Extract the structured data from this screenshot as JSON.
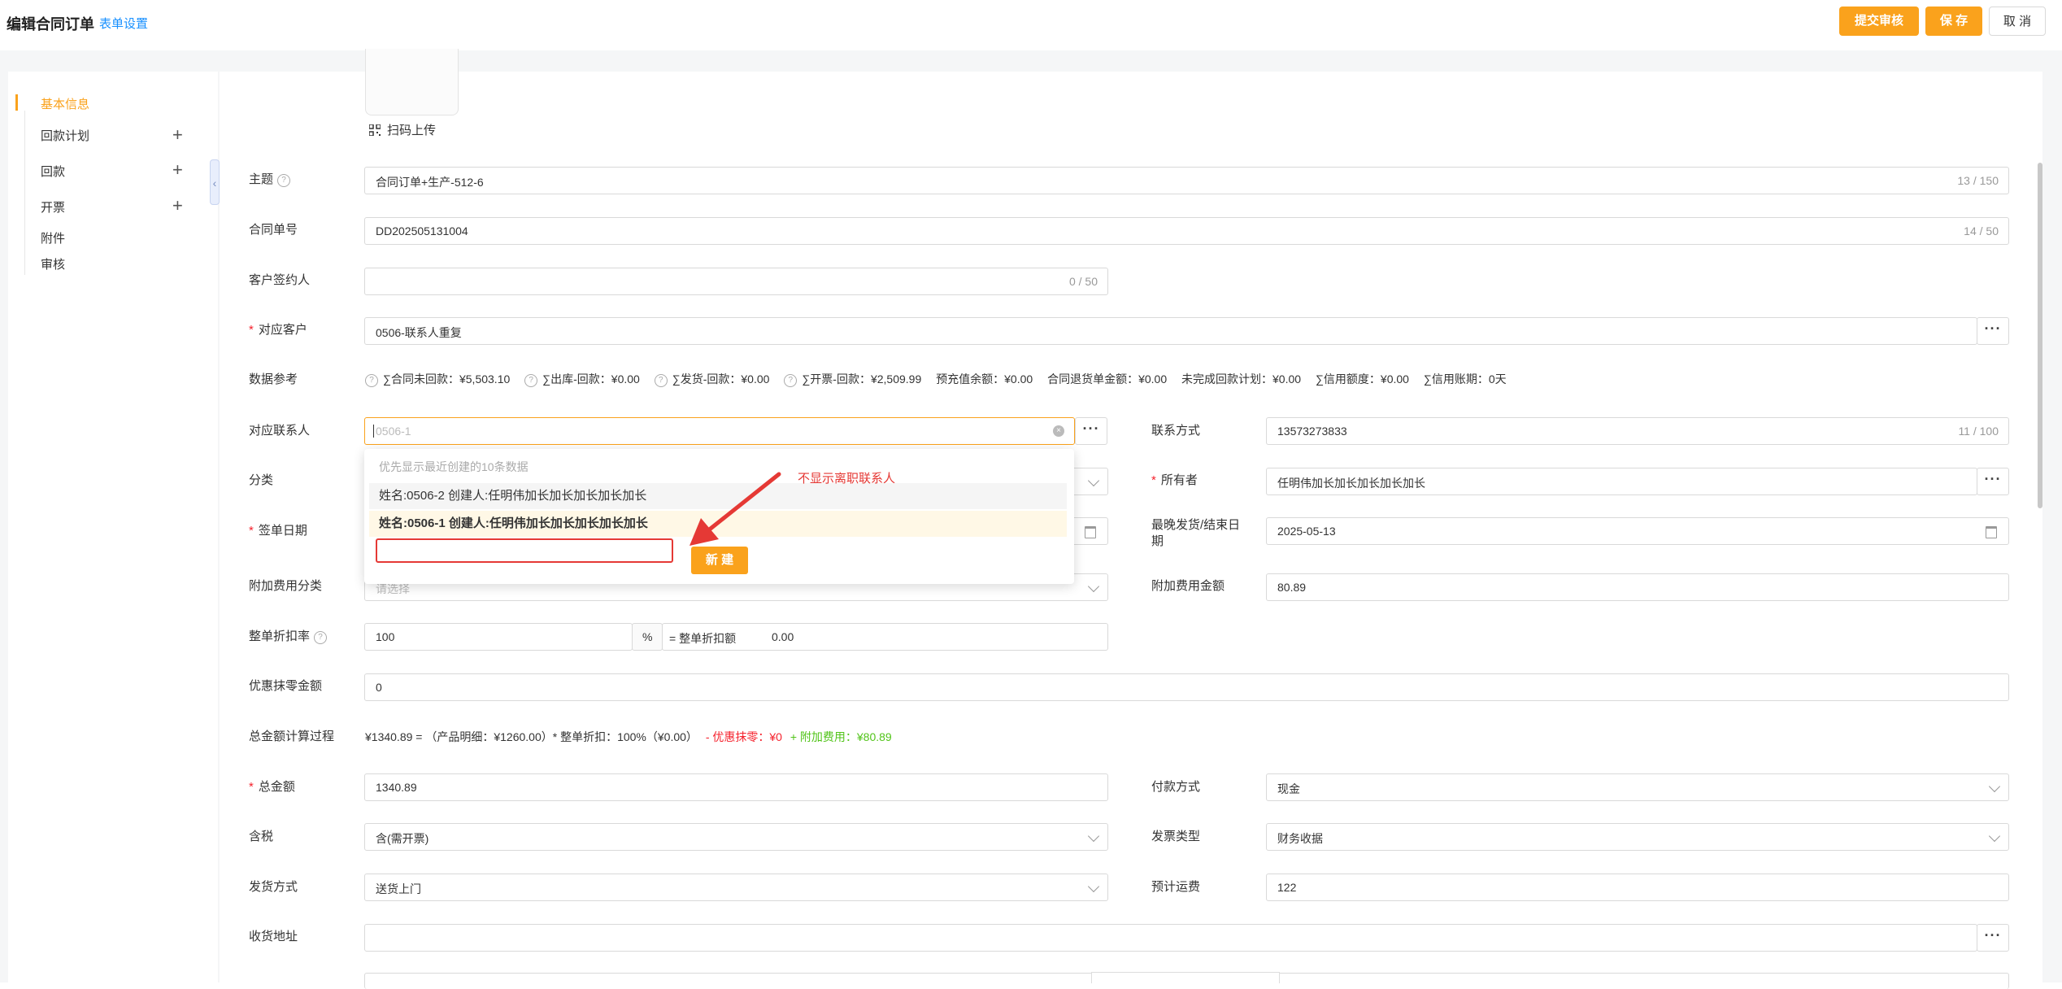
{
  "header": {
    "title": "编辑合同订单",
    "form_setting": "表单设置",
    "submit_label": "提交审核",
    "save_label": "保 存",
    "cancel_label": "取 消"
  },
  "sidebar": {
    "items": [
      {
        "label": "基本信息"
      },
      {
        "label": "回款计划"
      },
      {
        "label": "回款"
      },
      {
        "label": "开票"
      },
      {
        "label": "附件"
      },
      {
        "label": "审核"
      }
    ],
    "plus": "+"
  },
  "upload": {
    "scan_label": "扫码上传"
  },
  "form": {
    "subject": {
      "label": "主题",
      "value": "合同订单+生产-512-6",
      "count": "13 / 150"
    },
    "order_no": {
      "label": "合同单号",
      "value": "DD202505131004",
      "count": "14 / 50"
    },
    "signer": {
      "label": "客户签约人",
      "value": "",
      "count": "0 / 50"
    },
    "customer": {
      "label": "对应客户",
      "value": "0506-联系人重复"
    },
    "data_ref": {
      "label": "数据参考",
      "items": [
        "∑合同未回款：¥5,503.10",
        "∑出库-回款：¥0.00",
        "∑发货-回款：¥0.00",
        "∑开票-回款：¥2,509.99",
        "预充值余额：¥0.00",
        "合同退货单金额：¥0.00",
        "未完成回款计划：¥0.00",
        "∑信用额度：¥0.00",
        "∑信用账期：0天"
      ]
    },
    "contact": {
      "label": "对应联系人",
      "placeholder": "0506-1"
    },
    "contact_method": {
      "label": "联系方式",
      "value": "13573273833",
      "count": "11 / 100"
    },
    "category": {
      "label": "分类"
    },
    "owner": {
      "label": "所有者",
      "value": "任明伟加长加长加长加长加长"
    },
    "sign_date": {
      "label": "签单日期"
    },
    "latest_ship": {
      "label_line1": "最晚发货/结束日",
      "label_line2": "期",
      "value": "2025-05-13"
    },
    "extra_fee_cat": {
      "label": "附加费用分类",
      "placeholder": "请选择"
    },
    "extra_fee_amt": {
      "label": "附加费用金额",
      "value": "80.89"
    },
    "discount_rate": {
      "label": "整单折扣率",
      "value": "100",
      "unit": "%",
      "eq_label": "= 整单折扣额",
      "eq_value": "0.00"
    },
    "rounding": {
      "label": "优惠抹零金额",
      "value": "0"
    },
    "calc": {
      "label": "总金额计算过程",
      "part1": "¥1340.89 = （产品明细：¥1260.00）* 整单折扣：100%（¥0.00）",
      "part2": "- 优惠抹零：¥0",
      "part3": "+ 附加费用：¥80.89"
    },
    "total": {
      "label": "总金额",
      "value": "1340.89"
    },
    "payment": {
      "label": "付款方式",
      "value": "现金"
    },
    "tax": {
      "label": "含税",
      "value": "含(需开票)"
    },
    "invoice_type": {
      "label": "发票类型",
      "value": "财务收据"
    },
    "shipping": {
      "label": "发货方式",
      "value": "送货上门"
    },
    "freight": {
      "label": "预计运费",
      "value": "122"
    },
    "address": {
      "label": "收货地址",
      "value": ""
    }
  },
  "dropdown": {
    "hint": "优先显示最近创建的10条数据",
    "options": [
      "姓名:0506-2 创建人:任明伟加长加长加长加长加长",
      "姓名:0506-1 创建人:任明伟加长加长加长加长加长"
    ],
    "new_label": "新 建"
  },
  "annotation": {
    "text": "不显示离职联系人",
    "color": "#e53935"
  },
  "colors": {
    "accent": "#faa21c",
    "link": "#1890ff",
    "required": "#f5222d",
    "calc_red": "#f5222d",
    "calc_green": "#52c41a"
  }
}
